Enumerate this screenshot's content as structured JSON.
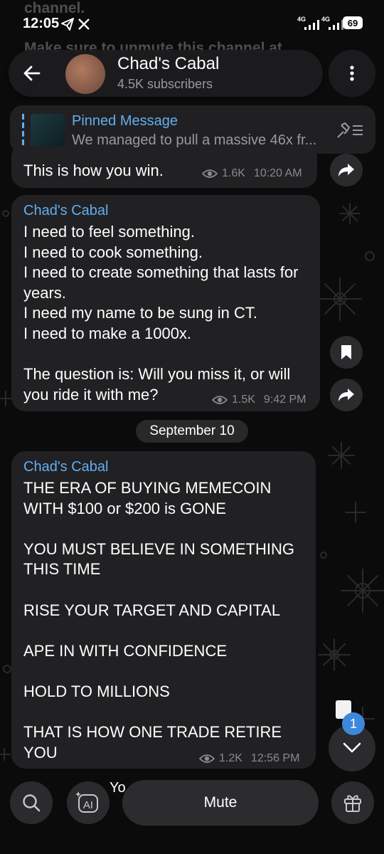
{
  "status_bar": {
    "time": "12:05",
    "network_1": "4G",
    "network_2": "4G",
    "battery": "69"
  },
  "background_text": {
    "line1": "channel.",
    "line2": "Make sure to unmute this channel at"
  },
  "header": {
    "title": "Chad's Cabal",
    "subtitle": "4.5K subscribers"
  },
  "pinned": {
    "label": "Pinned Message",
    "preview": "We managed to pull a massive 46x fr..."
  },
  "messages": [
    {
      "text": "This is how you win.",
      "views": "1.6K",
      "time": "10:20 AM"
    },
    {
      "sender": "Chad's Cabal",
      "text": "I need to feel something.\nI need to cook something.\nI need to create something that lasts for years.\nI need my name to be sung in CT.\nI need to make a 1000x.\n\nThe question is: Will you miss it, or will you ride it with me?",
      "views": "1.5K",
      "time": "9:42 PM"
    },
    {
      "sender": "Chad's Cabal",
      "text": "THE ERA OF BUYING MEMECOIN WITH $100 or $200 is GONE\n\nYOU MUST BELIEVE IN SOMETHING THIS TIME\n\nRISE YOUR TARGET AND CAPITAL\n\nAPE IN WITH CONFIDENCE\n\nHOLD TO MILLIONS\n\nTHAT IS HOW ONE TRADE RETIRE YOU",
      "views": "1.2K",
      "time": "12:56 PM"
    }
  ],
  "date_separator": "September 10",
  "unread_badge": "1",
  "next_preview": "Yo",
  "bottom": {
    "mute_label": "Mute"
  },
  "icons": [
    "back-icon",
    "more-icon",
    "unpin-list-icon",
    "share-icon",
    "bookmark-icon",
    "chevron-down-icon",
    "search-icon",
    "ai-sparkle-icon",
    "gift-icon",
    "eye-icon"
  ],
  "colors": {
    "accent": "#62aef0",
    "bubble": "#212123",
    "background": "#0b0b0c",
    "badge": "#3e88dc"
  }
}
